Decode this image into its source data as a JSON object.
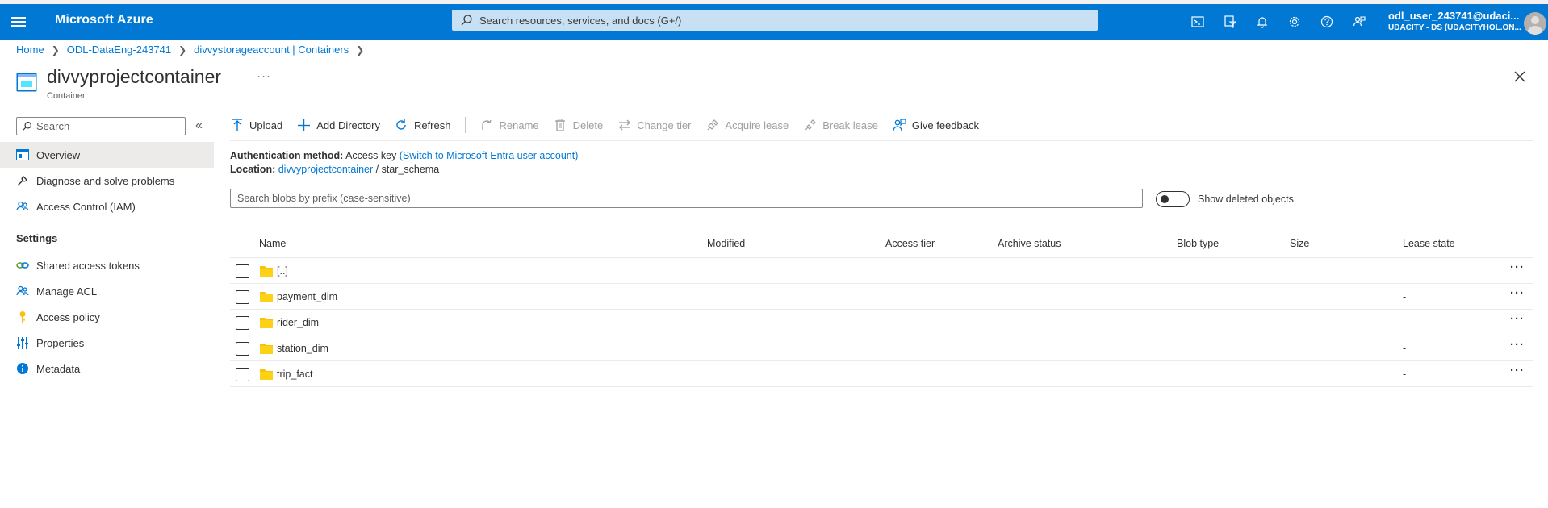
{
  "topbar": {
    "brand": "Microsoft Azure",
    "search_placeholder": "Search resources, services, and docs (G+/)",
    "user_name": "odl_user_243741@udaci...",
    "user_tenant": "UDACITY - DS (UDACITYHOL.ON...",
    "bg_color": "#0078d4"
  },
  "breadcrumb": [
    "Home",
    "ODL-DataEng-243741",
    "divvystorageaccount | Containers"
  ],
  "header": {
    "title": "divvyprojectcontainer",
    "subtitle": "Container",
    "more": "···"
  },
  "nav": {
    "search_placeholder": "Search",
    "collapse": "«",
    "items": [
      {
        "label": "Overview",
        "icon": "overview-icon"
      },
      {
        "label": "Diagnose and solve problems",
        "icon": "wrench-icon"
      },
      {
        "label": "Access Control (IAM)",
        "icon": "people-icon"
      }
    ],
    "settings_title": "Settings",
    "settings_items": [
      {
        "label": "Shared access tokens",
        "icon": "link-icon"
      },
      {
        "label": "Manage ACL",
        "icon": "people-icon"
      },
      {
        "label": "Access policy",
        "icon": "key-icon"
      },
      {
        "label": "Properties",
        "icon": "sliders-icon"
      },
      {
        "label": "Metadata",
        "icon": "info-icon"
      }
    ]
  },
  "toolbar": {
    "upload": "Upload",
    "add_directory": "Add Directory",
    "refresh": "Refresh",
    "rename": "Rename",
    "delete": "Delete",
    "change_tier": "Change tier",
    "acquire_lease": "Acquire lease",
    "break_lease": "Break lease",
    "give_feedback": "Give feedback"
  },
  "auth": {
    "label": "Authentication method:",
    "value": "Access key",
    "switch_link": "(Switch to Microsoft Entra user account)"
  },
  "location": {
    "label": "Location:",
    "container_link": "divvyprojectcontainer",
    "separator": "/",
    "path": "star_schema"
  },
  "blob_search_placeholder": "Search blobs by prefix (case-sensitive)",
  "show_deleted_label": "Show deleted objects",
  "table": {
    "columns": [
      "Name",
      "Modified",
      "Access tier",
      "Archive status",
      "Blob type",
      "Size",
      "Lease state"
    ],
    "rows": [
      {
        "name": "[..]",
        "lease_state": ""
      },
      {
        "name": "payment_dim",
        "lease_state": "-"
      },
      {
        "name": "rider_dim",
        "lease_state": "-"
      },
      {
        "name": "station_dim",
        "lease_state": "-"
      },
      {
        "name": "trip_fact",
        "lease_state": "-"
      }
    ],
    "row_more": "···"
  }
}
